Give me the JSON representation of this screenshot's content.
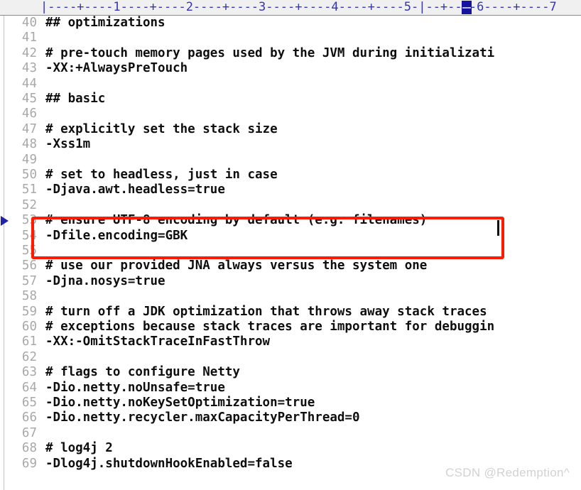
{
  "editor": {
    "ruler": {
      "text": "|----+----1----+----2----+----3----+----4----+----5-|--+----6----+----7",
      "caret_column": 51,
      "color": "#3333bb",
      "caret_color": "#1414a0"
    },
    "colors": {
      "background": "#ffffff",
      "gutter_background": "#f0f0f0",
      "line_number": "#a8a8a8",
      "code_text": "#0e0e0e",
      "annotation_box": "#ff1a00",
      "marker_arrow": "#2222aa",
      "watermark": "#d2d2d2"
    },
    "first_line_number": 40,
    "lines": [
      {
        "num": "40",
        "text": "## optimizations"
      },
      {
        "num": "41",
        "text": ""
      },
      {
        "num": "42",
        "text": "# pre-touch memory pages used by the JVM during initializati"
      },
      {
        "num": "43",
        "text": "-XX:+AlwaysPreTouch"
      },
      {
        "num": "44",
        "text": ""
      },
      {
        "num": "45",
        "text": "## basic"
      },
      {
        "num": "46",
        "text": ""
      },
      {
        "num": "47",
        "text": "# explicitly set the stack size"
      },
      {
        "num": "48",
        "text": "-Xss1m"
      },
      {
        "num": "49",
        "text": ""
      },
      {
        "num": "50",
        "text": "# set to headless, just in case"
      },
      {
        "num": "51",
        "text": "-Djava.awt.headless=true"
      },
      {
        "num": "52",
        "text": ""
      },
      {
        "num": "53",
        "text": "# ensure UTF-8 encoding by default (e.g. filenames)"
      },
      {
        "num": "54",
        "text": "-Dfile.encoding=GBK"
      },
      {
        "num": "55",
        "text": ""
      },
      {
        "num": "56",
        "text": "# use our provided JNA always versus the system one"
      },
      {
        "num": "57",
        "text": "-Djna.nosys=true"
      },
      {
        "num": "58",
        "text": ""
      },
      {
        "num": "59",
        "text": "# turn off a JDK optimization that throws away stack traces"
      },
      {
        "num": "60",
        "text": "# exceptions because stack traces are important for debuggin"
      },
      {
        "num": "61",
        "text": "-XX:-OmitStackTraceInFastThrow"
      },
      {
        "num": "62",
        "text": ""
      },
      {
        "num": "63",
        "text": "# flags to configure Netty"
      },
      {
        "num": "64",
        "text": "-Dio.netty.noUnsafe=true"
      },
      {
        "num": "65",
        "text": "-Dio.netty.noKeySetOptimization=true"
      },
      {
        "num": "66",
        "text": "-Dio.netty.recycler.maxCapacityPerThread=0"
      },
      {
        "num": "67",
        "text": ""
      },
      {
        "num": "68",
        "text": "# log4j 2"
      },
      {
        "num": "69",
        "text": "-Dlog4j.shutdownHookEnabled=false"
      }
    ],
    "marker_arrow_line": "53",
    "annotation": {
      "highlighted_lines": [
        "53",
        "54"
      ],
      "label": "red-highlight-box"
    },
    "caret": {
      "line": "53",
      "after_text": "# ensure UTF-8 encoding by default (e.g. filenames)"
    }
  },
  "watermark": {
    "text": "CSDN @Redemption^"
  }
}
